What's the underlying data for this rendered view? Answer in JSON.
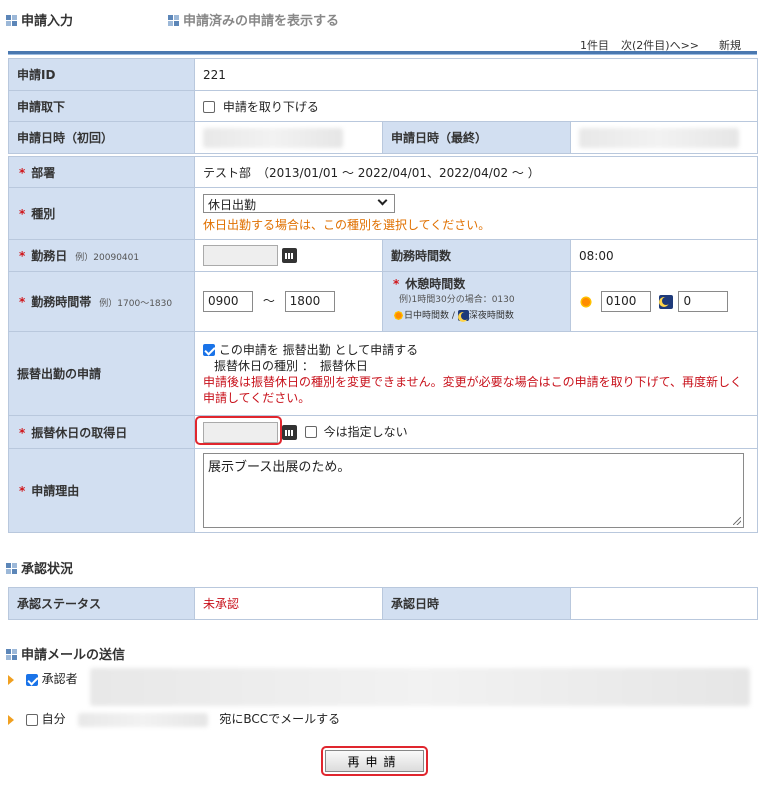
{
  "tabs": {
    "input": "申請入力",
    "list": "申請済みの申請を表示する"
  },
  "nav": {
    "count": "1件目",
    "next": "次(2件目)へ>>",
    "new": "新規"
  },
  "form": {
    "id_label": "申請ID",
    "id_value": "221",
    "withdraw_label": "申請取下",
    "withdraw_check": "申請を取り下げる",
    "date_first_label": "申請日時（初回）",
    "date_last_label": "申請日時（最終）",
    "dept_label": "部署",
    "dept_value": "テスト部　（2013/01/01 ～ 2022/04/01、2022/04/02 ～ ）",
    "type_label": "種別",
    "type_value": "休日出勤",
    "type_note": "休日出勤する場合は、この種別を選択してください。",
    "workday_label": "勤務日",
    "workday_example": "例）20090401",
    "hours_label": "勤務時間数",
    "hours_value": "08:00",
    "timeband_label": "勤務時間帯",
    "timeband_example": "例）1700～1830",
    "time_from": "0900",
    "time_sep": "～",
    "time_to": "1800",
    "break_label": "休憩時間数",
    "break_example": "例)1時間30分の場合：0130",
    "day_break_label": "日中時間数",
    "night_break_label": "深夜時間数",
    "sep_slash": "/",
    "day_break_value": "0100",
    "night_break_value": "0",
    "substitute_label": "振替出勤の申請",
    "substitute_check": "この申請を 振替出勤 として申請する",
    "substitute_type": "振替休日の種別 ：　振替休日",
    "substitute_warning": "申請後は振替休日の種別を変更できません。変更が必要な場合はこの申請を取り下げて、再度新しく申請してください。",
    "holiday_date_label": "振替休日の取得日",
    "holiday_unspecified": "今は指定しない",
    "reason_label": "申請理由",
    "reason_value": "展示ブース出展のため。"
  },
  "approval": {
    "title": "承認状況",
    "status_label": "承認ステータス",
    "status_value": "未承認",
    "date_label": "承認日時"
  },
  "mail": {
    "title": "申請メールの送信",
    "approver": "承認者",
    "self": "自分",
    "bcc_text": "宛にBCCでメールする"
  },
  "submit_label": "再申請",
  "colors": {
    "accent": "#4a78b0",
    "label_bg": "#d2dff1",
    "error": "#c8111b",
    "note": "#e07000"
  }
}
